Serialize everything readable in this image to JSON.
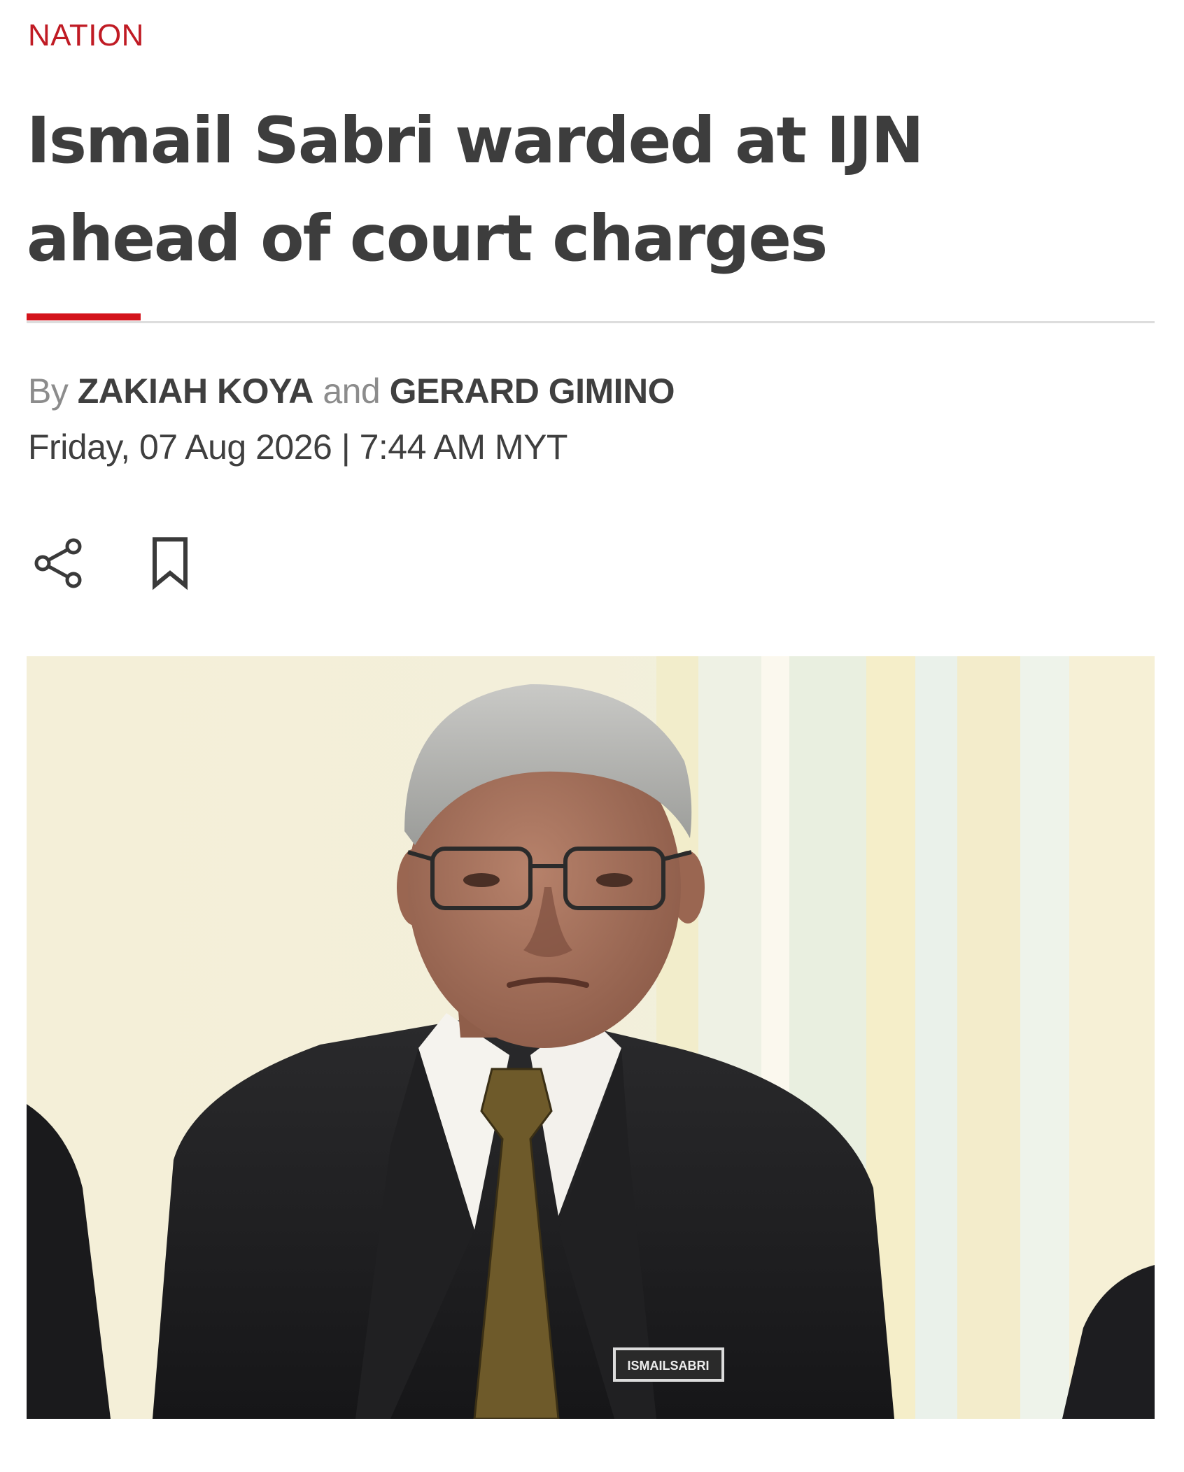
{
  "article": {
    "category": "NATION",
    "headline": "Ismail Sabri warded at IJN ahead of court charges",
    "byline": {
      "prefix": "By",
      "author1": "ZAKIAH KOYA",
      "conjunction": "and",
      "author2": "GERARD GIMINO"
    },
    "dateline": "Friday, 07 Aug 2026 | 7:44 AM MYT"
  },
  "actions": {
    "share_icon": "share-icon",
    "bookmark_icon": "bookmark-icon"
  },
  "photo": {
    "name_tag": "ISMAILSABRI"
  },
  "colors": {
    "accent": "#d4141c",
    "category": "#c01b24",
    "headline": "#3d3d3d",
    "muted": "#8c8c8c"
  }
}
